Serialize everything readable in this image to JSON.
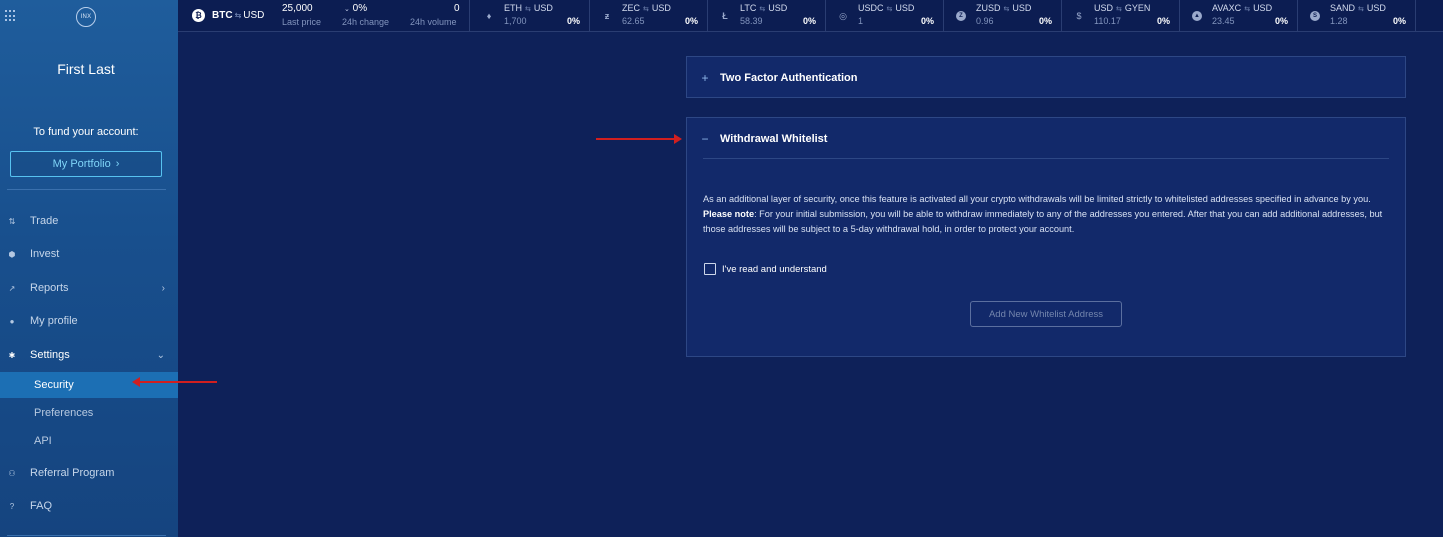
{
  "sidebar": {
    "logo_text": "INX",
    "user_name": "First Last",
    "fund_text": "To fund your account:",
    "portfolio_button": "My Portfolio",
    "nav": [
      {
        "label": "Trade",
        "icon": "trade-icon"
      },
      {
        "label": "Invest",
        "icon": "invest-icon"
      },
      {
        "label": "Reports",
        "icon": "reports-icon"
      },
      {
        "label": "My profile",
        "icon": "profile-icon"
      },
      {
        "label": "Settings",
        "icon": "gear-icon"
      }
    ],
    "settings_sub": [
      {
        "label": "Security"
      },
      {
        "label": "Preferences"
      },
      {
        "label": "API"
      }
    ],
    "nav_bottom": [
      {
        "label": "Referral Program",
        "icon": "users-icon"
      },
      {
        "label": "FAQ",
        "icon": "help-icon"
      }
    ]
  },
  "ticker": {
    "main": {
      "base": "BTC",
      "quote": "USD",
      "last_price": "25,000",
      "last_price_label": "Last price",
      "change": "0%",
      "change_label": "24h change",
      "volume": "0",
      "volume_label": "24h volume"
    },
    "pairs": [
      {
        "base": "ETH",
        "quote": "USD",
        "price": "1,700",
        "change": "0%",
        "icon": "ethereum-icon"
      },
      {
        "base": "ZEC",
        "quote": "USD",
        "price": "62.65",
        "change": "0%",
        "icon": "zcash-icon"
      },
      {
        "base": "LTC",
        "quote": "USD",
        "price": "58.39",
        "change": "0%",
        "icon": "litecoin-icon"
      },
      {
        "base": "USDC",
        "quote": "USD",
        "price": "1",
        "change": "0%",
        "icon": "usdc-icon"
      },
      {
        "base": "ZUSD",
        "quote": "USD",
        "price": "0.96",
        "change": "0%",
        "icon": "zusd-icon"
      },
      {
        "base": "USD",
        "quote": "GYEN",
        "price": "110.17",
        "change": "0%",
        "icon": "dollar-icon"
      },
      {
        "base": "AVAXC",
        "quote": "USD",
        "price": "23.45",
        "change": "0%",
        "icon": "avalanche-icon"
      },
      {
        "base": "SAND",
        "quote": "USD",
        "price": "1.28",
        "change": "0%",
        "icon": "sand-icon"
      }
    ]
  },
  "main": {
    "two_factor": {
      "title": "Two Factor Authentication",
      "toggle": "+"
    },
    "whitelist": {
      "title": "Withdrawal Whitelist",
      "toggle": "−",
      "desc_part1": "As an additional layer of security, once this feature is activated all your crypto withdrawals will be limited strictly to whitelisted addresses specified in advance by you. ",
      "desc_bold": "Please note",
      "desc_part2": ": For your initial submission, you will be able to withdraw immediately to any of the addresses you entered. After that you can add additional addresses, but those addresses will be subject to a 5-day withdrawal hold, in order to protect your account.",
      "checkbox_label": "I've read and understand",
      "add_button": "Add New Whitelist Address"
    }
  },
  "colors": {
    "background": "#0e2159",
    "sidebar": "#1f5d9c",
    "active_item": "#1c6fb4",
    "accent": "#57c2f0",
    "annotation_arrow": "#d11f1f"
  }
}
